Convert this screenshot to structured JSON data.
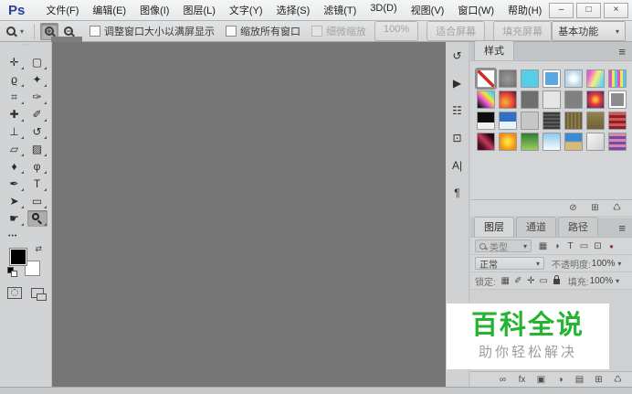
{
  "window": {
    "app_logo": "Ps",
    "controls": [
      {
        "name": "minimize-button",
        "glyph": "–"
      },
      {
        "name": "maximize-button",
        "glyph": "□"
      },
      {
        "name": "close-button",
        "glyph": "×"
      }
    ]
  },
  "menubar": {
    "items": [
      {
        "name": "menu-file",
        "label": "文件(F)"
      },
      {
        "name": "menu-edit",
        "label": "编辑(E)"
      },
      {
        "name": "menu-image",
        "label": "图像(I)"
      },
      {
        "name": "menu-layer",
        "label": "图层(L)"
      },
      {
        "name": "menu-type",
        "label": "文字(Y)"
      },
      {
        "name": "menu-select",
        "label": "选择(S)"
      },
      {
        "name": "menu-filter",
        "label": "滤镜(T)"
      },
      {
        "name": "menu-3d",
        "label": "3D(D)"
      },
      {
        "name": "menu-view",
        "label": "视图(V)"
      },
      {
        "name": "menu-window",
        "label": "窗口(W)"
      },
      {
        "name": "menu-help",
        "label": "帮助(H)"
      }
    ]
  },
  "options_bar": {
    "zoom_in_sign": "+",
    "zoom_out_sign": "−",
    "checkboxes": [
      {
        "name": "resize-windows-to-fit-checkbox",
        "label": "调整窗口大小以满屏显示"
      },
      {
        "name": "zoom-all-windows-checkbox",
        "label": "缩放所有窗口"
      },
      {
        "name": "scrubby-zoom-checkbox",
        "label": "细微缩放",
        "cls": "disabled"
      }
    ],
    "buttons": [
      {
        "name": "zoom-100-button",
        "label": "100%"
      },
      {
        "name": "fit-screen-button",
        "label": "适合屏幕"
      },
      {
        "name": "fill-screen-button",
        "label": "填充屏幕"
      }
    ],
    "workspace": {
      "label": "基本功能"
    }
  },
  "toolbar": {
    "more_label": "•••",
    "swap_icon": "⇄",
    "foreground_color": "#000000",
    "background_color": "#ffffff",
    "tools": [
      {
        "name": "move-tool",
        "glyph": "✛"
      },
      {
        "name": "rectangular-marquee-tool",
        "glyph": "▢"
      },
      {
        "name": "lasso-tool",
        "glyph": "ϱ"
      },
      {
        "name": "magic-wand-tool",
        "glyph": "✦"
      },
      {
        "name": "crop-tool",
        "glyph": "⌗"
      },
      {
        "name": "eyedropper-tool",
        "glyph": "✑"
      },
      {
        "name": "healing-brush-tool",
        "glyph": "✚"
      },
      {
        "name": "brush-tool",
        "glyph": "✐"
      },
      {
        "name": "clone-stamp-tool",
        "glyph": "⊥"
      },
      {
        "name": "history-brush-tool",
        "glyph": "↺"
      },
      {
        "name": "eraser-tool",
        "glyph": "▱"
      },
      {
        "name": "gradient-tool",
        "glyph": "▨"
      },
      {
        "name": "blur-tool",
        "glyph": "♦"
      },
      {
        "name": "dodge-tool",
        "glyph": "φ"
      },
      {
        "name": "pen-tool",
        "glyph": "✒"
      },
      {
        "name": "type-tool",
        "glyph": "T"
      },
      {
        "name": "path-selection-tool",
        "glyph": "➤"
      },
      {
        "name": "rectangle-shape-tool",
        "glyph": "▭"
      },
      {
        "name": "hand-tool",
        "glyph": "☛"
      },
      {
        "name": "zoom-tool",
        "glyph": "",
        "cls": "tool-mag",
        "selected": true
      }
    ]
  },
  "dock_strip": {
    "icons": [
      {
        "name": "history-panel-icon",
        "glyph": "↺"
      },
      {
        "name": "actions-panel-icon",
        "glyph": "▶"
      },
      {
        "name": "adjustments-panel-icon",
        "glyph": "☷"
      },
      {
        "name": "clone-source-panel-icon",
        "glyph": "⊡"
      },
      {
        "name": "character-panel-icon",
        "glyph": "A|"
      },
      {
        "name": "paragraph-panel-icon",
        "glyph": "¶"
      }
    ]
  },
  "styles_panel": {
    "tab_label": "样式",
    "menu_icon": "≡",
    "swatches": [
      {
        "name": "style-none",
        "cls": "swatch-none",
        "selected": true
      },
      {
        "name": "style-swatch",
        "bg": "radial-gradient(circle,#9a9a9a,#6f6f6f)"
      },
      {
        "name": "style-swatch",
        "bg": "#55cfe8"
      },
      {
        "name": "style-swatch",
        "bg": "#59a8e2",
        "cls": "framed"
      },
      {
        "name": "style-swatch",
        "bg": "radial-gradient(circle,#ffffff 15%,#b9d4e8 70%)"
      },
      {
        "name": "style-swatch",
        "bg": "linear-gradient(115deg,#e85ad8 15%,#f4ef7d 50%,#66d9ef 85%)"
      },
      {
        "name": "style-swatch",
        "bg": "repeating-linear-gradient(90deg,#e052c8 0 3px,#f2e650 3px 6px,#52c8e0 6px 9px)"
      },
      {
        "name": "style-swatch",
        "bg": "linear-gradient(45deg,#1a1a1a 10%,#e84fd4 40%,#f3e63a 65%,#3ad4f3 90%)"
      },
      {
        "name": "style-swatch",
        "bg": "radial-gradient(circle at 35% 65%,#f7b733,#e2403a 55%,#451531)"
      },
      {
        "name": "style-swatch",
        "bg": "#6e6e6e"
      },
      {
        "name": "style-swatch",
        "bg": "#e6e6e6"
      },
      {
        "name": "style-swatch",
        "bg": "#808080"
      },
      {
        "name": "style-swatch",
        "bg": "radial-gradient(circle,#ffc03a 10%,#e23a3a 45%,#4a2a7a)"
      },
      {
        "name": "style-swatch",
        "bg": "#8c8c8c",
        "cls": "framed"
      },
      {
        "name": "style-swatch",
        "bg": "linear-gradient(180deg,#0d0d0d 60%,#f0f0f0 60%)"
      },
      {
        "name": "style-swatch",
        "bg": "linear-gradient(180deg,#2f6fc4 55%,#e8f4fb 55%)"
      },
      {
        "name": "style-swatch",
        "bg": "#c6c6c6"
      },
      {
        "name": "style-swatch",
        "bg": "repeating-linear-gradient(0deg,#3c3c3c 0 2px,#5a5a5a 2px 4px)"
      },
      {
        "name": "style-swatch",
        "bg": "repeating-linear-gradient(90deg,#6e6038 0 2px,#8a7a4c 2px 4px)"
      },
      {
        "name": "style-swatch",
        "bg": "linear-gradient(180deg,#93824e,#6e6038)"
      },
      {
        "name": "style-swatch",
        "bg": "repeating-linear-gradient(0deg,#8e1f2e 0 3px,#d2574e 3px 6px)"
      },
      {
        "name": "style-swatch",
        "bg": "linear-gradient(45deg,#4a0a28 20%,#c23a5a 50%,#2a0515 80%)"
      },
      {
        "name": "style-swatch",
        "bg": "radial-gradient(circle,#ffe23a 15%,#f08a1a 75%)"
      },
      {
        "name": "style-swatch",
        "bg": "linear-gradient(180deg,#2e7d32,#9ccc65)"
      },
      {
        "name": "style-swatch",
        "bg": "linear-gradient(180deg,#8ec9ec,#f6fcff)"
      },
      {
        "name": "style-swatch",
        "bg": "linear-gradient(180deg,#3a8ad4 45%,#d4b97a 55%)"
      },
      {
        "name": "style-swatch",
        "bg": "linear-gradient(135deg,#f5f5f5,#cfcfcf)"
      },
      {
        "name": "style-swatch",
        "bg": "repeating-linear-gradient(0deg,#7a4aa0 0 3px,#d08ab4 3px 6px)"
      }
    ],
    "footer_icons": [
      {
        "name": "clear-style-button",
        "glyph": "⊘"
      },
      {
        "name": "new-style-button",
        "glyph": "⊞"
      },
      {
        "name": "delete-style-button",
        "glyph": "♺"
      }
    ]
  },
  "layers_panel": {
    "tabs": [
      {
        "name": "tab-layers",
        "label": "图层",
        "selected": true
      },
      {
        "name": "tab-channels",
        "label": "通道"
      },
      {
        "name": "tab-paths",
        "label": "路径"
      }
    ],
    "menu_icon": "≡",
    "filter_label": "类型",
    "filter_icons": [
      {
        "name": "filter-pixel-layers-icon",
        "glyph": "▦"
      },
      {
        "name": "filter-adjustment-layers-icon",
        "glyph": "◑"
      },
      {
        "name": "filter-type-layers-icon",
        "glyph": "T"
      },
      {
        "name": "filter-shape-layers-icon",
        "glyph": "▭"
      },
      {
        "name": "filter-smart-objects-icon",
        "glyph": "⊡"
      },
      {
        "name": "filter-toggle-icon",
        "glyph": "●",
        "cls": "filter-dot"
      }
    ],
    "blend_mode": "正常",
    "opacity_label": "不透明度:",
    "opacity_value": "100%",
    "lock_label": "锁定:",
    "lock_icons": [
      {
        "name": "lock-transparency-icon",
        "glyph": "▦"
      },
      {
        "name": "lock-paint-icon",
        "glyph": "✐"
      },
      {
        "name": "lock-position-icon",
        "glyph": "✛"
      },
      {
        "name": "lock-artboard-icon",
        "glyph": "▭"
      },
      {
        "name": "lock-all-icon",
        "glyph": "",
        "cls": "lockicon"
      }
    ],
    "fill_label": "填充:",
    "fill_value": "100%",
    "footer_icons": [
      {
        "name": "link-layers-icon",
        "glyph": "∞"
      },
      {
        "name": "layer-effects-icon",
        "glyph": "fx"
      },
      {
        "name": "layer-mask-icon",
        "glyph": "▣"
      },
      {
        "name": "adjustment-layer-icon",
        "glyph": "◑"
      },
      {
        "name": "new-group-icon",
        "glyph": "▤"
      },
      {
        "name": "new-layer-icon",
        "glyph": "⊞"
      },
      {
        "name": "delete-layer-icon",
        "glyph": "♺"
      }
    ]
  },
  "watermark": {
    "title": "百科全说",
    "subtitle": "助你轻松解决",
    "title_color": "#25b432",
    "subtitle_color": "#9c9c9c"
  },
  "colors": {
    "canvas": "#767676",
    "logo_blue": "#26439b"
  }
}
